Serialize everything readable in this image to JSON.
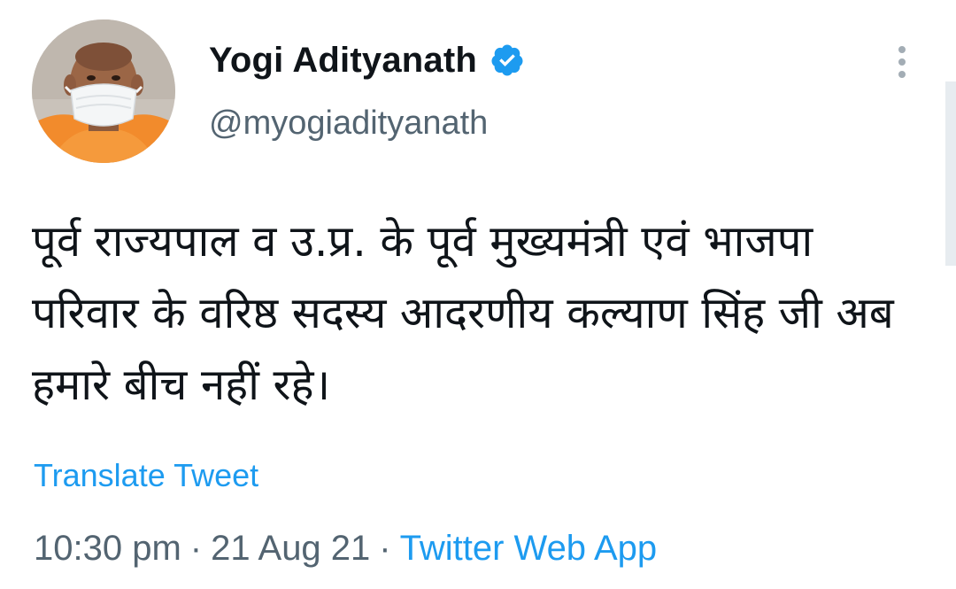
{
  "user": {
    "display_name": "Yogi Adityanath",
    "handle": "@myogiadityanath",
    "verified_icon": "verified-badge-icon",
    "avatar_icon": "profile-photo-masked-man"
  },
  "tweet": {
    "text": "पूर्व राज्यपाल व उ.प्र. के पूर्व मुख्यमंत्री एवं भाजपा परिवार के वरिष्ठ सदस्य आदरणीय कल्याण सिंह जी अब हमारे बीच नहीं रहे।",
    "translate_label": "Translate Tweet",
    "time": "10:30 pm",
    "date": "21 Aug 21",
    "separator": "·",
    "source": "Twitter Web App"
  },
  "icons": {
    "more": "vertical-ellipsis-icon"
  },
  "colors": {
    "accent": "#1d9bf0",
    "text_primary": "#0f1419",
    "text_secondary": "#536471"
  }
}
